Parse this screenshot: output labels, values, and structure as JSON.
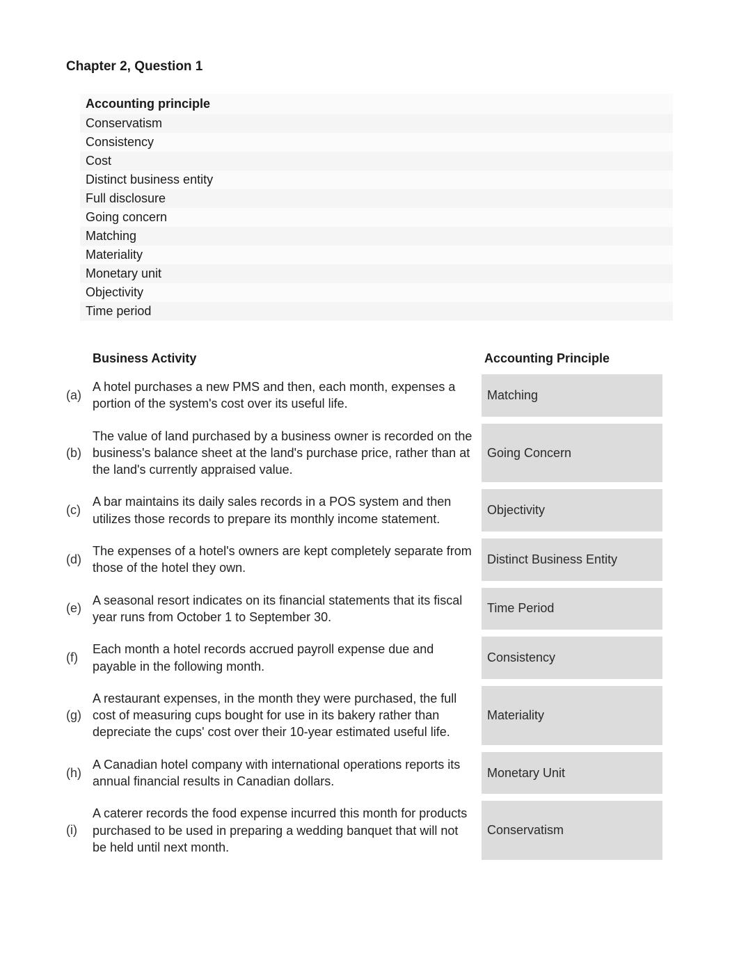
{
  "title": "Chapter 2, Question 1",
  "principles_header": "Accounting principle",
  "principles": [
    "Conservatism",
    "Consistency",
    "Cost",
    "Distinct business entity",
    "Full disclosure",
    "Going concern",
    "Matching",
    "Materiality",
    "Monetary unit",
    "Objectivity",
    "Time period"
  ],
  "activity_header": "Business Activity",
  "answer_header": "Accounting Principle",
  "questions": [
    {
      "label": "(a)",
      "activity": "A hotel purchases a new PMS and then, each month, expenses a portion of the system's cost over its useful life.",
      "answer": "Matching"
    },
    {
      "label": "(b)",
      "activity": "The value of land purchased by a business owner is recorded on the business's balance sheet at the land's purchase price, rather than at the land's currently appraised value.",
      "answer": "Going Concern"
    },
    {
      "label": "(c)",
      "activity": "A bar maintains its daily sales records in a POS system and then utilizes those records to prepare its monthly income statement.",
      "answer": "Objectivity"
    },
    {
      "label": "(d)",
      "activity": "The expenses of a hotel's owners are kept completely separate from those of the hotel they own.",
      "answer": "Distinct Business Entity"
    },
    {
      "label": "(e)",
      "activity": "A seasonal resort indicates on its financial statements that its fiscal year runs from October 1 to September 30.",
      "answer": "Time Period"
    },
    {
      "label": "(f)",
      "activity": "Each month a hotel records accrued payroll expense due and payable in the following month.",
      "answer": "Consistency"
    },
    {
      "label": "(g)",
      "activity": "A restaurant expenses, in the month they were purchased, the full cost of measuring cups bought for use in its bakery rather than depreciate the cups' cost over their 10-year estimated useful life.",
      "answer": "Materiality"
    },
    {
      "label": "(h)",
      "activity": "A Canadian hotel company with international operations reports its annual financial results in Canadian dollars.",
      "answer": "Monetary Unit"
    },
    {
      "label": "(i)",
      "activity": "A caterer records the food expense incurred this month for products purchased to be used in preparing a wedding banquet that will not be held until next month.",
      "answer": "Conservatism"
    }
  ]
}
